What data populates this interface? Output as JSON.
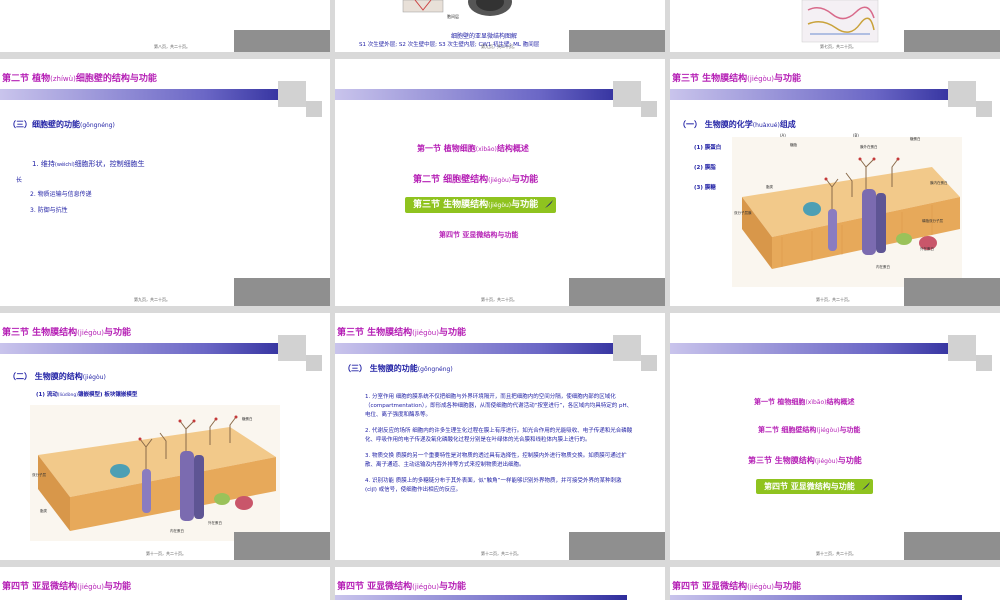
{
  "slides": {
    "s1": {
      "footer": "第八页，共二十页。"
    },
    "s2": {
      "caption": "细胞壁的亚显微结构图解",
      "legend": "S1  次生壁外层;  S2  次生壁中层;  S3  次生壁内层;  CW1  初生壁;  ML  胞间层",
      "footer": "第九页，共二十页。",
      "labels": [
        "胞间层"
      ]
    },
    "s3": {
      "footer": "第七页，共二十页。"
    },
    "s4": {
      "title": "第二节  植物",
      "title_py": "(zhíwù)",
      "title_rest": "细胞壁的结构与功能",
      "subtitle": "（三）细胞壁的功能",
      "subtitle_py": "(gōngnéng)",
      "item1a": "1. 维持",
      "item1a_py": "(wéichí)",
      "item1b": "细胞形状，控制细胞生",
      "item1c": "长",
      "item2": "2. 物质运输与信息传递",
      "item3": "3. 防御与抗性",
      "footer": "第九页，共二十页。"
    },
    "s5": {
      "m1": "第一节  植物细胞",
      "m1_py": "(xìbāo)",
      "m1_rest": "结构概述",
      "m2": "第二节  细胞壁结构",
      "m2_py": "(jiégòu)",
      "m2_rest": "与功能",
      "m3": "第三节  生物膜结构",
      "m3_py": "(jiégòu)",
      "m3_rest": "与功能",
      "m4": "第四节  亚显微结构与功能",
      "footer": "第十页，共二十页。"
    },
    "s6": {
      "title": "第三节  生物膜结构",
      "title_py": "(jiégòu)",
      "title_rest": "与功能",
      "subtitle": "（一） 生物膜的化学",
      "subtitle_py": "(huàxué)",
      "subtitle_rest": "组成",
      "list": [
        "(1)  膜蛋白",
        "(2)  膜脂",
        "(3)  膜糖"
      ],
      "fig_a": "(A)",
      "fig_b": "(B)",
      "footer": "第十页，共二十页。",
      "labels": [
        "糖蛋白",
        "糖脂",
        "膜外在蛋白",
        "膜内在蛋白",
        "双分子层膜",
        "脂类",
        "磷脂双分子层",
        "外在蛋白",
        "内在蛋白"
      ]
    },
    "s7": {
      "title": "第三节  生物膜结构",
      "title_py": "(jiégòu)",
      "title_rest": "与功能",
      "subtitle": "（二）  生物膜的结构",
      "subtitle_py": "(jiégòu)",
      "model": "(1)  流动",
      "model_py": "(liúdòng)",
      "model_rest": "镶嵌模型)  板块镶嵌模型",
      "footer": "第十一页，共二十页。",
      "labels": [
        "糖蛋白",
        "双分子层",
        "脂类",
        "外在蛋白",
        "内在蛋白"
      ]
    },
    "s8": {
      "title": "第三节  生物膜结构",
      "title_py": "(jiégòu)",
      "title_rest": "与功能",
      "subtitle": "（三）  生物膜的功能",
      "subtitle_py": "(gōngnéng)",
      "p1": "1. 分室作用    细胞的膜系统不仅把细胞与外界环境隔开，而且把细胞内的空间分隔，使细胞内部的区域化（compartmentation），即形成各种细胞器，从而使细胞的代谢活动“按室进行”，各区域内均具特定的 pH、电位、离子强度和酶系等。",
      "p2": "2. 代谢反应的场所    细胞内的许多生理生化过程在膜上有序进行。如光合作用的光能吸收、电子传递和光合磷酸化、呼吸作用的电子传递及氧化磷酸化过程分别是在叶绿体的光合膜和线粒体内膜上进行的。",
      "p3": "3. 物质交换    质膜的另一个重要特性是对物质的透过具有选择性，控制膜内外进行物质交换。如质膜可通过扩散、离子通道、主动运输及内吞外排等方式来控制物质进出细胞。",
      "p4": "4. 识别功能    质膜上的多糖链分布于其外表面，似“触角”一样能够识别外界物质，并可接受外界的某种刺激 (cìjī) 或信号，使细胞作出相应的反应。",
      "footer": "第十二页，共二十页。"
    },
    "s9": {
      "m1": "第一节  植物细胞",
      "m1_py": "(xìbāo)",
      "m1_rest": "结构概述",
      "m2": "第二节  细胞壁结构",
      "m2_py": "(jiégòu)",
      "m2_rest": "与功能",
      "m3": "第三节  生物膜结构",
      "m3_py": "(jiégòu)",
      "m3_rest": "与功能",
      "m4": "第四节  亚显微结构与功能",
      "footer": "第十三页，共二十页。"
    },
    "s10": {
      "title": "第四节  亚显微结构",
      "title_py": "(jiégòu)",
      "title_rest": "与功能"
    },
    "s11": {
      "title": "第四节  亚显微结构",
      "title_py": "(jiégòu)",
      "title_rest": "与功能"
    },
    "s12": {
      "title": "第四节  亚显微结构",
      "title_py": "(jiégòu)",
      "title_rest": "与功能"
    }
  },
  "colors": {
    "title": "#b51fb5",
    "body": "#2323a6",
    "highlight": "#8fc31f"
  }
}
